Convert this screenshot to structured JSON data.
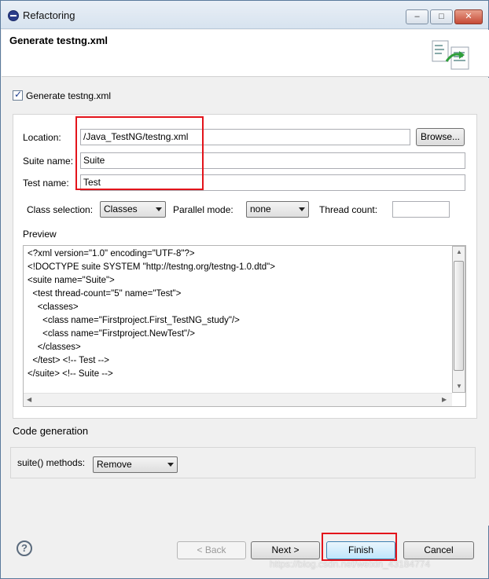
{
  "window": {
    "title": "Refactoring"
  },
  "header": {
    "title": "Generate testng.xml",
    "icon": "refactoring-wizard-icon"
  },
  "generate": {
    "checkbox_label": "Generate testng.xml",
    "checked": true
  },
  "form": {
    "location_label": "Location:",
    "location_value": "/Java_TestNG/testng.xml",
    "browse_label": "Browse...",
    "suite_name_label": "Suite name:",
    "suite_name_value": "Suite",
    "test_name_label": "Test name:",
    "test_name_value": "Test",
    "class_selection_label": "Class selection:",
    "class_selection_value": "Classes",
    "parallel_mode_label": "Parallel mode:",
    "parallel_mode_value": "none",
    "thread_count_label": "Thread count:",
    "thread_count_value": ""
  },
  "preview": {
    "label": "Preview",
    "lines": [
      "<?xml version=\"1.0\" encoding=\"UTF-8\"?>",
      "<!DOCTYPE suite SYSTEM \"http://testng.org/testng-1.0.dtd\">",
      "<suite name=\"Suite\">",
      "  <test thread-count=\"5\" name=\"Test\">",
      "    <classes>",
      "      <class name=\"Firstproject.First_TestNG_study\"/>",
      "      <class name=\"Firstproject.NewTest\"/>",
      "    </classes>",
      "  </test> <!-- Test -->",
      "</suite> <!-- Suite -->"
    ]
  },
  "code_generation": {
    "label": "Code generation",
    "suite_methods_label": "suite() methods:",
    "suite_methods_value": "Remove"
  },
  "footer": {
    "back_label": "< Back",
    "next_label": "Next >",
    "finish_label": "Finish",
    "cancel_label": "Cancel"
  },
  "watermark": "https://blog.csdn.net/weixin_43184774",
  "colors": {
    "highlight": "#e3141b",
    "title_bar": "#d7e3ef"
  }
}
